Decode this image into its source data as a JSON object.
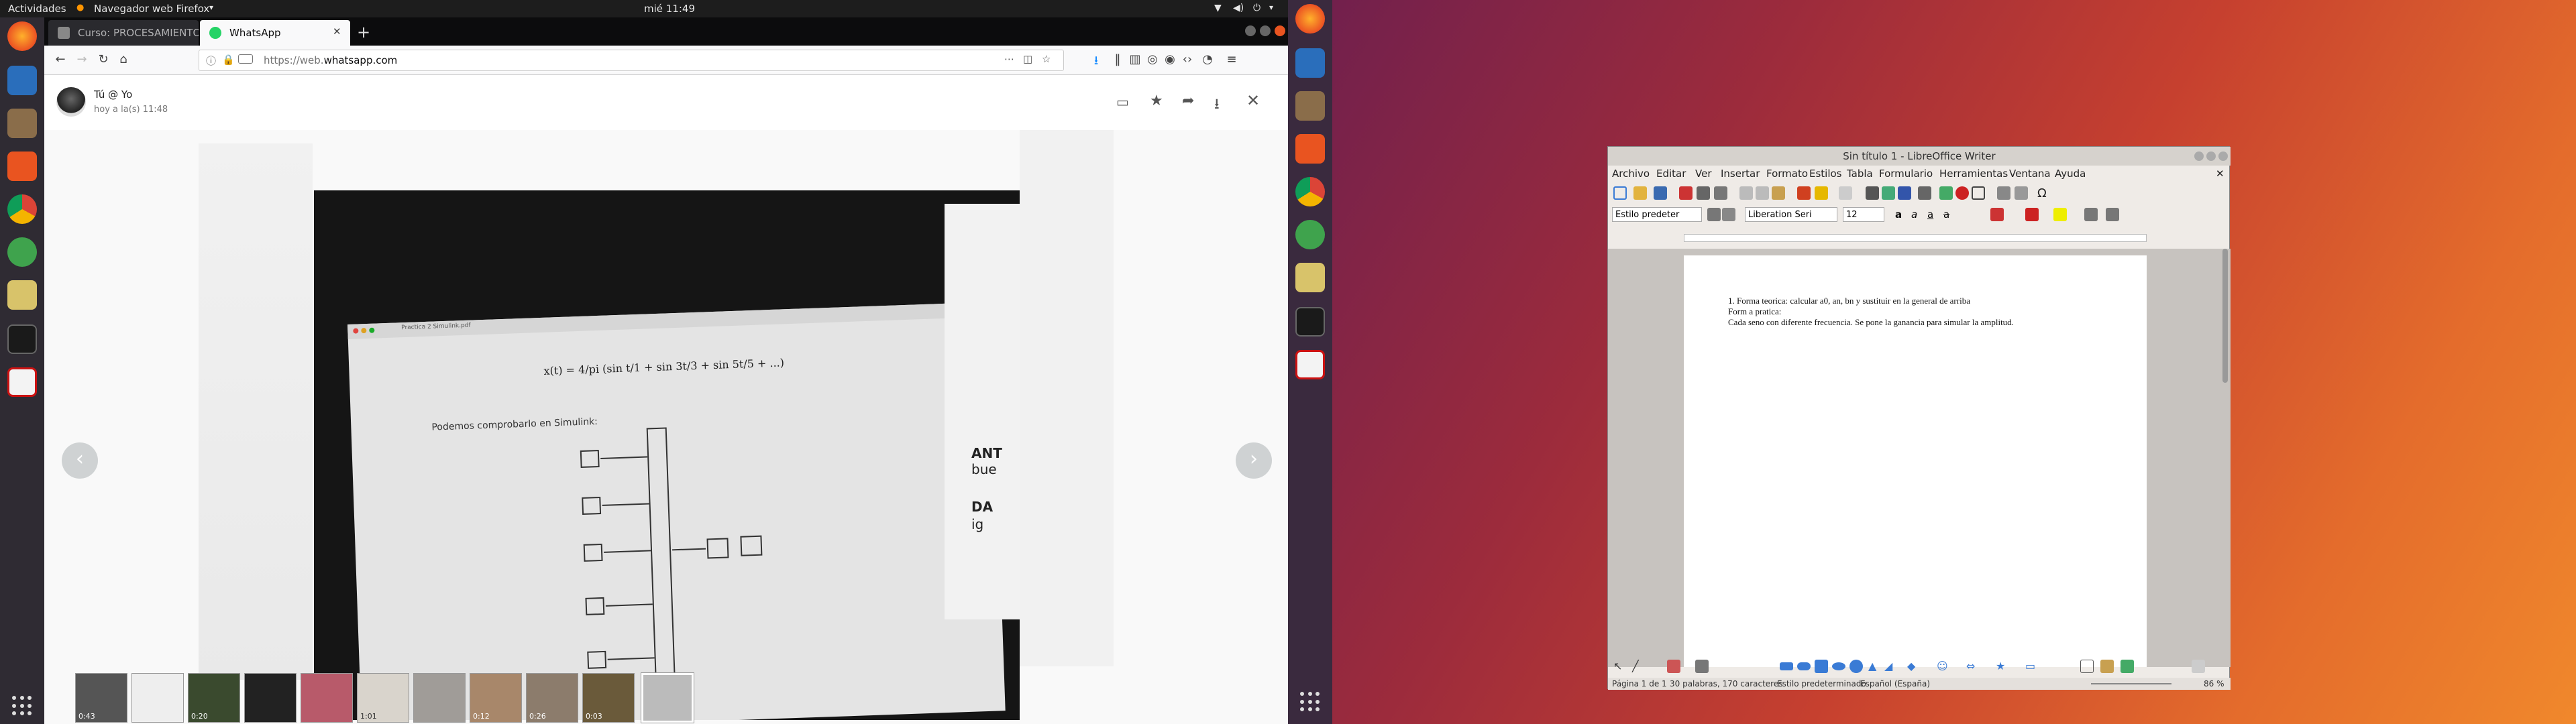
{
  "topbar": {
    "activities": "Actividades",
    "app_menu": "Navegador web Firefox",
    "clock": "mié 11:49"
  },
  "firefox": {
    "tabs": [
      {
        "label": "Curso: PROCESAMIENTO"
      },
      {
        "label": "WhatsApp"
      }
    ],
    "url_prefix": "https://web.",
    "url_domain": "whatsapp.com"
  },
  "whatsapp": {
    "sender": "Tú @ Yo",
    "timestamp": "hoy a la(s) 11:48"
  },
  "photo": {
    "window_title": "Practica 2 Simulink.pdf",
    "formula": "x(t) = 4/pi (sin t/1 + sin 3t/3 + sin 5t/5 + ...)",
    "caption": "Podemos comprobarlo en Simulink:",
    "side_texts": [
      "ANT",
      "bue",
      "DA",
      "ig"
    ]
  },
  "thumbnails": {
    "durations": [
      "0:43",
      "",
      "0:20",
      "",
      "",
      "1:01",
      "",
      "0:12",
      "0:26",
      "0:03",
      ""
    ]
  },
  "libreoffice": {
    "title": "Sin título 1 - LibreOffice Writer",
    "menu": [
      "Archivo",
      "Editar",
      "Ver",
      "Insertar",
      "Formato",
      "Estilos",
      "Tabla",
      "Formulario",
      "Herramientas",
      "Ventana",
      "Ayuda"
    ],
    "style_box": "Estilo predeter",
    "font_box": "Liberation Seri",
    "size_box": "12",
    "doc_lines": [
      "1. Forma teorica: calcular a0, an, bn y sustituir en la general de arriba",
      "Form a pratica:",
      "Cada seno con diferente frecuencia. Se pone la ganancia para simular la amplitud."
    ],
    "status": {
      "page": "Página 1 de 1",
      "words": "30 palabras, 170 caracteres",
      "style": "Estilo predeterminado",
      "language": "Español (España)",
      "zoom": "86 %"
    }
  }
}
